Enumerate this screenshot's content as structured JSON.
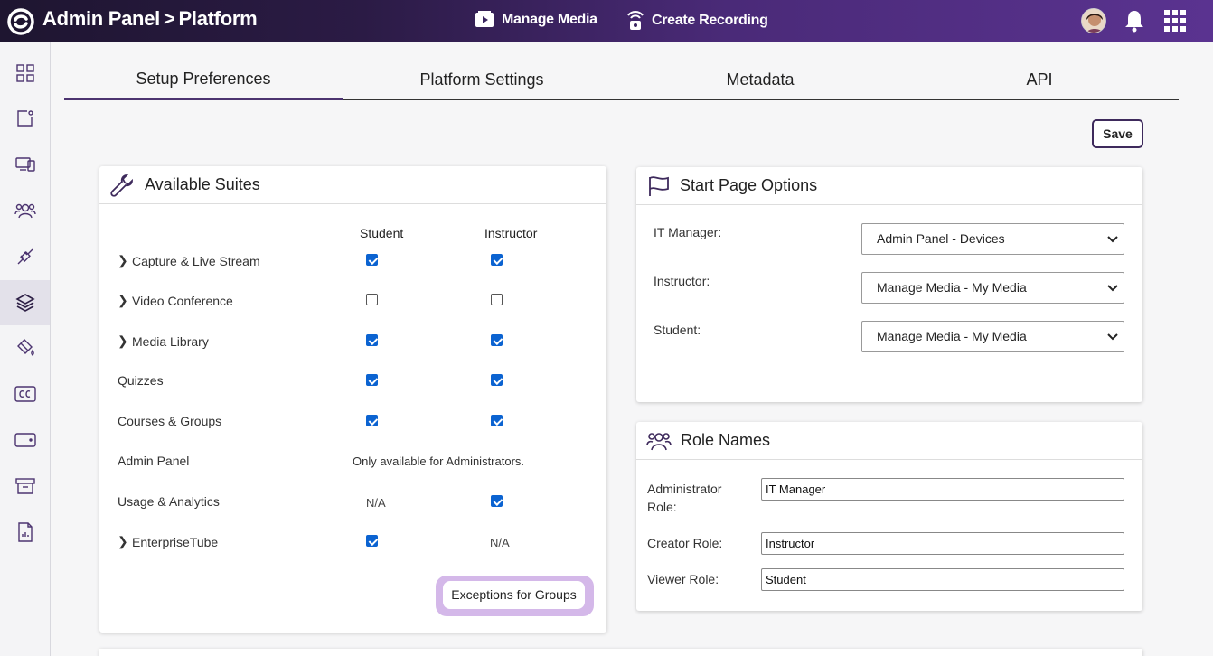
{
  "header": {
    "title": "Admin Panel",
    "separator": ">",
    "subtitle": "Platform",
    "manage_media": "Manage Media",
    "create_recording": "Create Recording"
  },
  "sidebar": {
    "items": [
      {
        "icon": "dashboard-icon"
      },
      {
        "icon": "new-item-icon"
      },
      {
        "icon": "devices-icon"
      },
      {
        "icon": "users-icon"
      },
      {
        "icon": "integrations-icon"
      },
      {
        "icon": "layers-icon",
        "active": true
      },
      {
        "icon": "paint-bucket-icon"
      },
      {
        "icon": "captions-icon"
      },
      {
        "icon": "card-icon"
      },
      {
        "icon": "archive-icon"
      },
      {
        "icon": "report-icon"
      }
    ]
  },
  "tabs": [
    {
      "label": "Setup Preferences",
      "active": true
    },
    {
      "label": "Platform Settings"
    },
    {
      "label": "Metadata"
    },
    {
      "label": "API"
    }
  ],
  "save_label": "Save",
  "suites": {
    "title": "Available Suites",
    "col_student": "Student",
    "col_instructor": "Instructor",
    "rows": [
      {
        "label": "Capture & Live Stream",
        "expandable": true,
        "student": true,
        "instructor": true
      },
      {
        "label": "Video Conference",
        "expandable": true,
        "student": false,
        "instructor": false
      },
      {
        "label": "Media Library",
        "expandable": true,
        "student": true,
        "instructor": true
      },
      {
        "label": "Quizzes",
        "student": true,
        "instructor": true
      },
      {
        "label": "Courses & Groups",
        "student": true,
        "instructor": true
      },
      {
        "label": "Admin Panel",
        "note": "Only available for Administrators."
      },
      {
        "label": "Usage & Analytics",
        "student": "N/A",
        "instructor": true
      },
      {
        "label": "EnterpriseTube",
        "expandable": true,
        "student": true,
        "instructor": "N/A"
      }
    ],
    "exceptions_button": "Exceptions for Groups"
  },
  "start_page": {
    "title": "Start Page Options",
    "options": [
      {
        "label": "IT Manager:",
        "value": "Admin Panel - Devices"
      },
      {
        "label": "Instructor:",
        "value": "Manage Media - My Media"
      },
      {
        "label": "Student:",
        "value": "Manage Media - My Media"
      }
    ]
  },
  "role_names": {
    "title": "Role Names",
    "admin_label": "Administrator Role:",
    "admin_value": "IT Manager",
    "creator_label": "Creator Role:",
    "creator_value": "Instructor",
    "viewer_label": "Viewer Role:",
    "viewer_value": "Student"
  },
  "colors": {
    "accent": "#4c3470",
    "checkbox": "#0b63d1",
    "highlight": "#d4b8e9"
  }
}
